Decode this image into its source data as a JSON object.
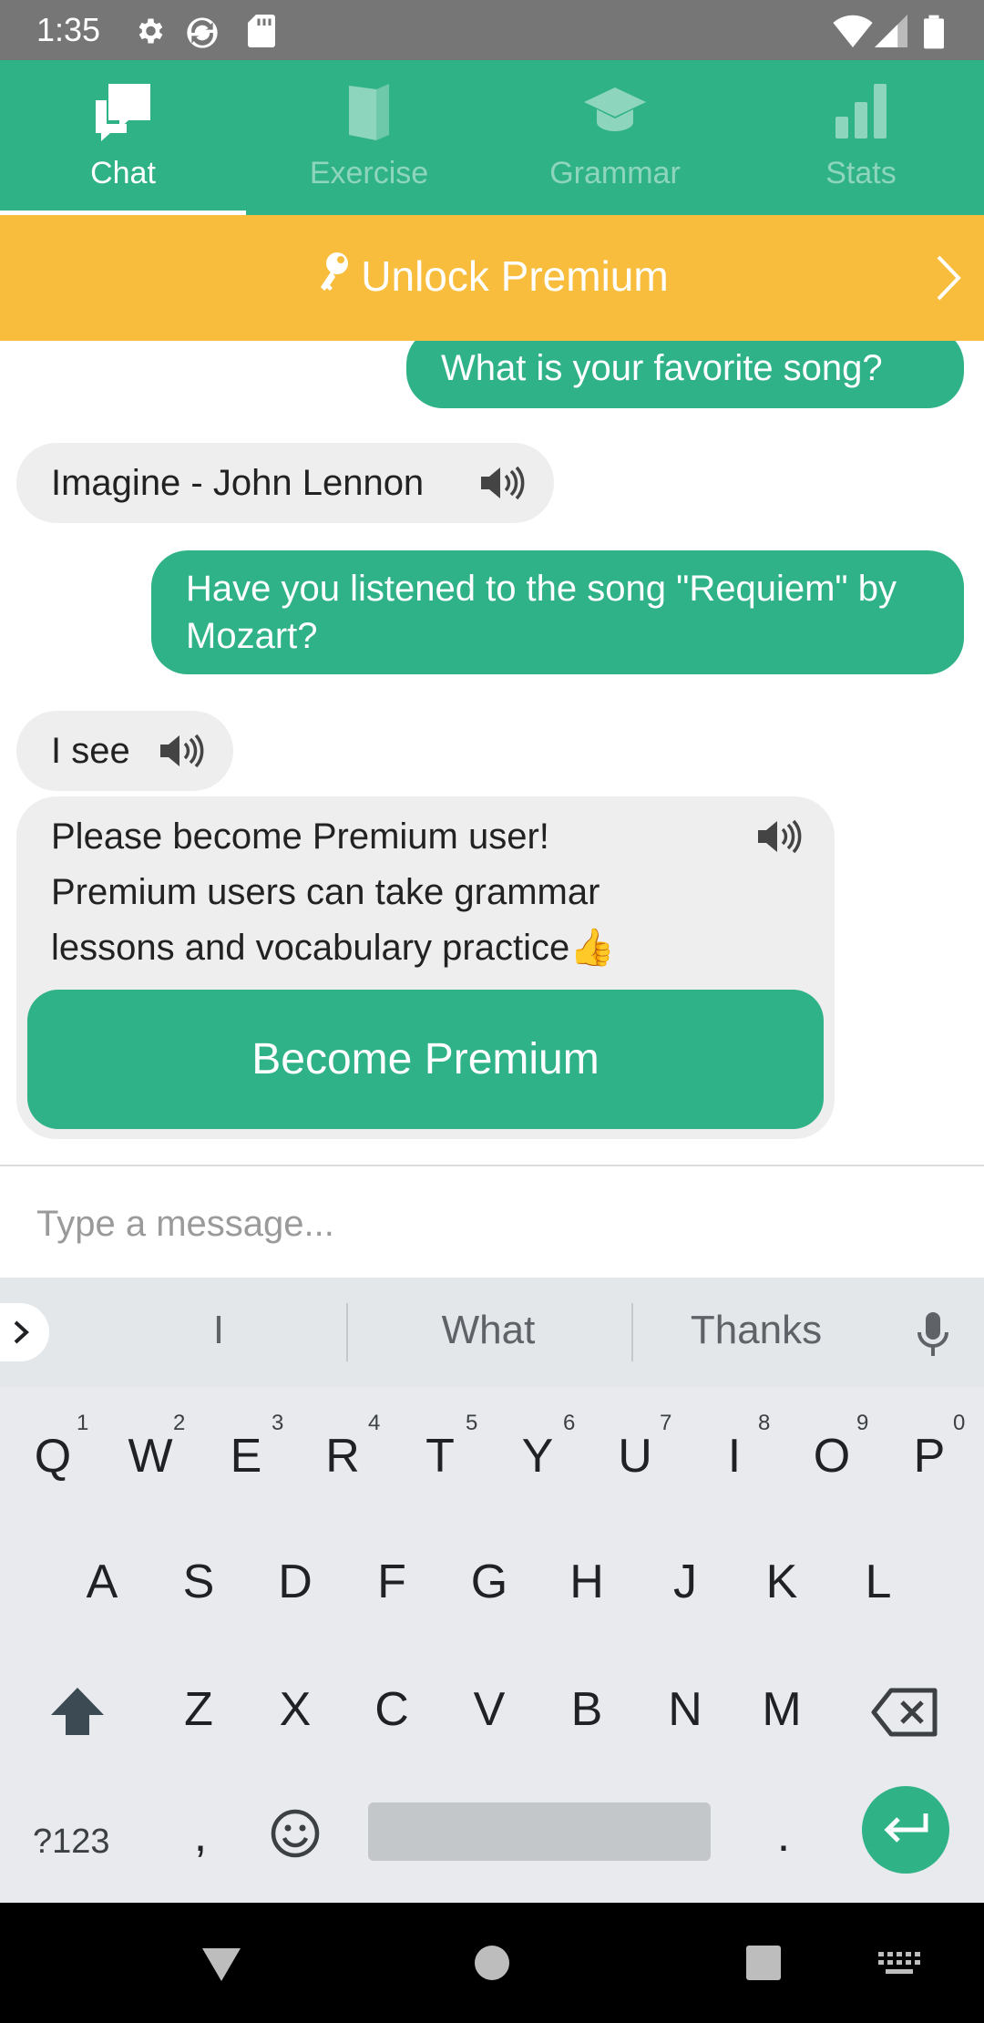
{
  "status_bar": {
    "time": "1:35"
  },
  "tabs": [
    {
      "label": "Chat",
      "active": true,
      "icon": "chat-icon"
    },
    {
      "label": "Exercise",
      "active": false,
      "icon": "book-icon"
    },
    {
      "label": "Grammar",
      "active": false,
      "icon": "graduation-cap-icon"
    },
    {
      "label": "Stats",
      "active": false,
      "icon": "bar-chart-icon"
    }
  ],
  "banner": {
    "label": "Unlock Premium",
    "icon": "key-icon"
  },
  "messages": [
    {
      "from": "me",
      "text": "What is your favorite song?"
    },
    {
      "from": "bot",
      "text": "Imagine - John Lennon"
    },
    {
      "from": "me",
      "text": "Have you listened to the song \"Requiem\" by Mozart?"
    },
    {
      "from": "bot",
      "text": "I see"
    },
    {
      "from": "bot",
      "text": "Please become Premium user! Premium users can take grammar lessons and vocabulary practice👍",
      "button": "Become Premium"
    }
  ],
  "input": {
    "placeholder": "Type a message..."
  },
  "keyboard": {
    "suggestions": [
      "I",
      "What",
      "Thanks"
    ],
    "row1": [
      "Q",
      "W",
      "E",
      "R",
      "T",
      "Y",
      "U",
      "I",
      "O",
      "P"
    ],
    "row1_hints": [
      "1",
      "2",
      "3",
      "4",
      "5",
      "6",
      "7",
      "8",
      "9",
      "0"
    ],
    "row2": [
      "A",
      "S",
      "D",
      "F",
      "G",
      "H",
      "J",
      "K",
      "L"
    ],
    "row3": [
      "Z",
      "X",
      "C",
      "V",
      "B",
      "N",
      "M"
    ],
    "symbols_key": "?123",
    "comma": ",",
    "period": "."
  },
  "colors": {
    "accent": "#30b287",
    "banner": "#f8bd3c",
    "bot_bubble": "#eeeeee"
  }
}
